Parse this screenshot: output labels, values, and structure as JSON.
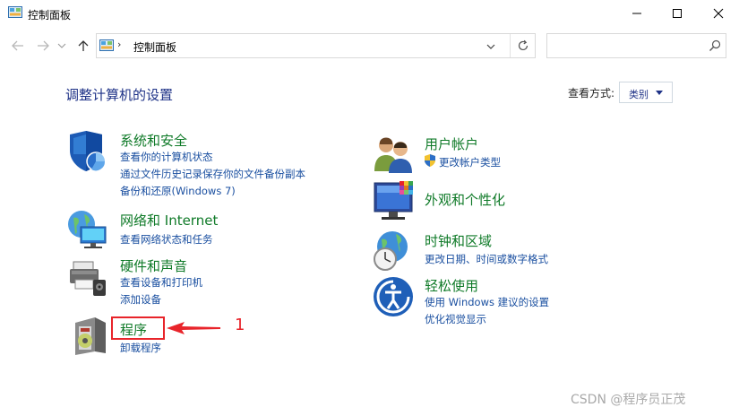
{
  "window": {
    "title": "控制面板"
  },
  "address_bar": {
    "separator": "›",
    "path": "控制面板"
  },
  "search": {
    "placeholder": ""
  },
  "header": {
    "title": "调整计算机的设置",
    "view_by_label": "查看方式:",
    "view_by_value": "类别"
  },
  "categories": {
    "system": {
      "title": "系统和安全",
      "links": [
        "查看你的计算机状态",
        "通过文件历史记录保存你的文件备份副本",
        "备份和还原(Windows 7)"
      ]
    },
    "network": {
      "title": "网络和 Internet",
      "links": [
        "查看网络状态和任务"
      ]
    },
    "hardware": {
      "title": "硬件和声音",
      "links": [
        "查看设备和打印机",
        "添加设备"
      ]
    },
    "programs": {
      "title": "程序",
      "links": [
        "卸载程序"
      ]
    },
    "user": {
      "title": "用户帐户",
      "links": [
        "更改帐户类型"
      ]
    },
    "appearance": {
      "title": "外观和个性化",
      "links": []
    },
    "clock": {
      "title": "时钟和区域",
      "links": [
        "更改日期、时间或数字格式"
      ]
    },
    "ease": {
      "title": "轻松使用",
      "links": [
        "使用 Windows 建议的设置",
        "优化视觉显示"
      ]
    }
  },
  "annotation": {
    "number": "1"
  },
  "watermark": "CSDN @程序员正茂",
  "colors": {
    "category_title": "#0f7a28",
    "link": "#1a4fa0",
    "heading": "#1e3287",
    "annotation": "#e8242a"
  }
}
